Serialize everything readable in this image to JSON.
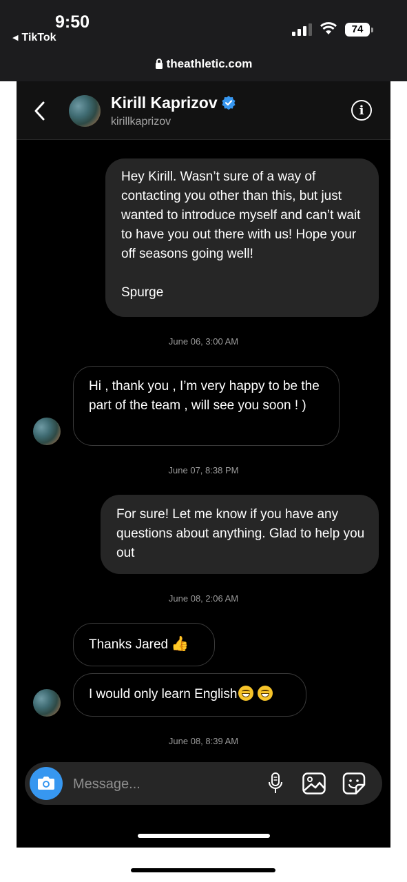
{
  "status_bar": {
    "time": "9:50",
    "back_app": "TikTok",
    "battery": "74",
    "url": "theathletic.com"
  },
  "header": {
    "name": "Kirill Kaprizov",
    "handle": "kirillkaprizov",
    "info_glyph": "i",
    "icons": [
      "chevron-left-icon",
      "verified-badge-icon",
      "info-icon"
    ]
  },
  "messages": [
    {
      "from": "me",
      "text": "Hey Kirill. Wasn’t sure of a way of contacting you other than this, but just wanted to introduce myself and can’t wait to have you out there with us! Hope your off seasons going well!\n\nSpurge"
    },
    {
      "timestamp": "June 06, 3:00 AM"
    },
    {
      "from": "them",
      "text": "Hi , thank you , I’m very happy to be the part of the team , will see you soon ! )"
    },
    {
      "timestamp": "June 07, 8:38 PM"
    },
    {
      "from": "me",
      "text": "For sure! Let me know if you have any questions about anything. Glad to help you out"
    },
    {
      "timestamp": "June 08, 2:06 AM"
    },
    {
      "from": "them",
      "text": "Thanks Jared",
      "emoji": "👍"
    },
    {
      "from": "them",
      "text": "I would only learn English",
      "emoji": "😁😁"
    },
    {
      "timestamp": "June 08, 8:39 AM"
    }
  ],
  "composer": {
    "placeholder": "Message...",
    "icons": [
      "camera-icon",
      "microphone-icon",
      "gallery-icon",
      "sticker-icon"
    ]
  },
  "colors": {
    "background": "#000000",
    "sent_bubble": "#262626",
    "received_border": "#3a3a3a",
    "verified_blue": "#3797f0",
    "camera_blue": "#3797f0"
  }
}
